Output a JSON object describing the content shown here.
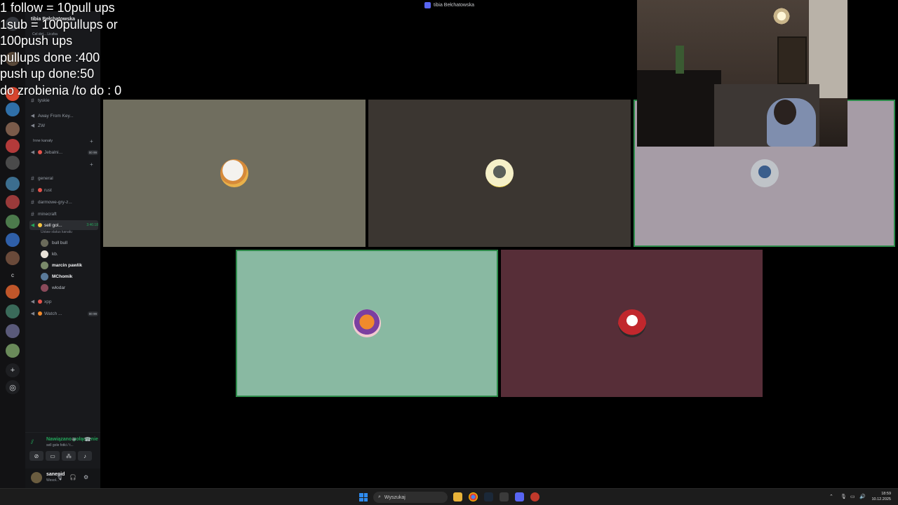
{
  "window": {
    "title": "tibia Bełchatowska"
  },
  "overlay": {
    "lines": [
      "1 follow = 10pull ups",
      "1sub = 100pullups or",
      "100push ups",
      "pullups done :400",
      "push up done:50",
      "do zrobienia /to do : 0"
    ]
  },
  "channels": {
    "server_name": "tibia Bełchatowska",
    "server_sub": "Cel dot...   Liczba",
    "items": [
      {
        "type": "text",
        "label": "tyskie"
      },
      {
        "type": "voice",
        "label": "Away From Key..."
      },
      {
        "type": "voice",
        "label": "ZW"
      },
      {
        "type": "category",
        "label": "Inne kanały"
      },
      {
        "type": "voice",
        "label": "Jebalni...",
        "count": "00 99"
      },
      {
        "type": "category",
        "label": ""
      },
      {
        "type": "text",
        "label": "general"
      },
      {
        "type": "text",
        "label": "rust"
      },
      {
        "type": "text",
        "label": "darmowe-gry-z..."
      },
      {
        "type": "text",
        "label": "minecraft"
      },
      {
        "type": "voice",
        "label": "sell gol...",
        "time": "3:46:18",
        "active": true,
        "sub": "Ustaw status kanału"
      },
      {
        "type": "voice",
        "label": "xpp"
      },
      {
        "type": "voice",
        "label": "Watch ...",
        "count": "00 99"
      }
    ],
    "members": [
      {
        "name": "bull bull",
        "bold": false
      },
      {
        "name": "kb.",
        "bold": false
      },
      {
        "name": "marcin pawlik",
        "bold": true
      },
      {
        "name": "MChomik",
        "bold": true
      },
      {
        "name": "włodar",
        "bold": false
      }
    ]
  },
  "voice_panel": {
    "status": "Nawiązano połączenie",
    "channel": "sell gole fotki / t..."
  },
  "user_panel": {
    "name": "sanepid",
    "status": "Wesoł..."
  },
  "server_list": {
    "letter": "c"
  },
  "tiles": [
    {
      "avatar": "polar-bear-avatar",
      "bg": "#706e5f"
    },
    {
      "avatar": "cartoon-avatar",
      "bg": "#3b3631"
    },
    {
      "avatar": "person-avatar",
      "bg": "#a69ca6",
      "speaking": true
    },
    {
      "avatar": "patrick-avatar",
      "bg": "#89b9a2",
      "speaking": true
    },
    {
      "avatar": "police-avatar",
      "bg": "#572e38"
    }
  ],
  "taskbar": {
    "search_placeholder": "Wyszukaj",
    "time": "18:59",
    "date": "10.12.2025"
  },
  "colors": {
    "speaking_border": "#2e8c4b",
    "accent": "#5865f2",
    "online": "#23a55a"
  }
}
